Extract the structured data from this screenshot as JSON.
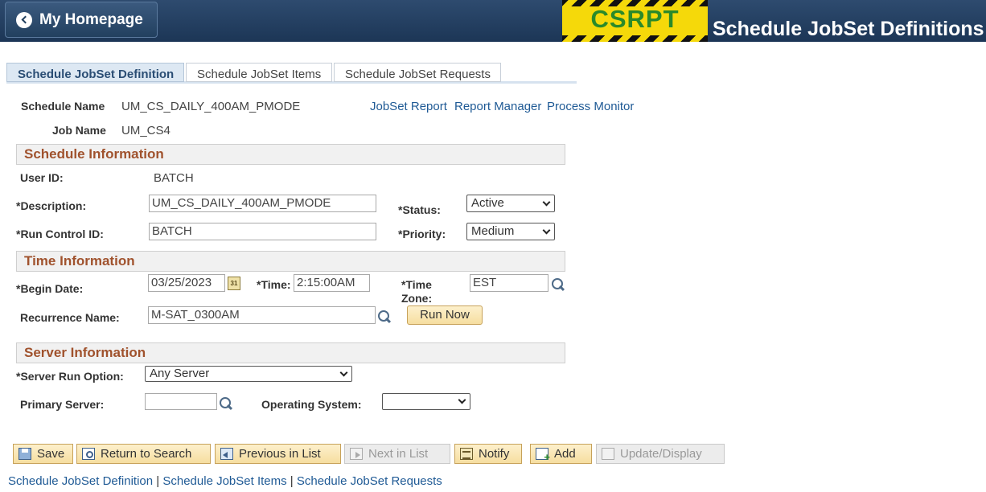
{
  "header": {
    "home_label": "My Homepage",
    "env_label": "CSRPT",
    "page_title": "Schedule JobSet Definitions"
  },
  "tabs": [
    {
      "label": "Schedule JobSet Definition",
      "active": true
    },
    {
      "label": "Schedule JobSet Items",
      "active": false
    },
    {
      "label": "Schedule JobSet Requests",
      "active": false
    }
  ],
  "top": {
    "schedule_name_label": "Schedule Name",
    "schedule_name": "UM_CS_DAILY_400AM_PMODE",
    "job_name_label": "Job Name",
    "job_name": "UM_CS4",
    "links": [
      "JobSet Report",
      "Report Manager",
      "Process Monitor"
    ]
  },
  "schedule_info": {
    "title": "Schedule Information",
    "user_id_label": "User ID:",
    "user_id": "BATCH",
    "description_label": "*Description:",
    "description": "UM_CS_DAILY_400AM_PMODE",
    "status_label": "*Status:",
    "status": "Active",
    "run_control_label": "*Run Control ID:",
    "run_control": "BATCH",
    "priority_label": "*Priority:",
    "priority": "Medium"
  },
  "time_info": {
    "title": "Time Information",
    "begin_date_label": "*Begin Date:",
    "begin_date": "03/25/2023",
    "calendar_text": "31",
    "time_label": "*Time:",
    "time": "2:15:00AM",
    "time_zone_label_1": "*Time",
    "time_zone_label_2": "Zone:",
    "time_zone": "EST",
    "recurrence_label": "Recurrence Name:",
    "recurrence": "M-SAT_0300AM",
    "run_now_label": "Run Now"
  },
  "server_info": {
    "title": "Server Information",
    "run_option_label": "*Server Run Option:",
    "run_option": "Any Server",
    "primary_server_label": "Primary Server:",
    "primary_server": "",
    "os_label": "Operating System:",
    "os": ""
  },
  "toolbar": {
    "save": "Save",
    "return_to_search": "Return to Search",
    "previous_in_list": "Previous in List",
    "next_in_list": "Next in List",
    "notify": "Notify",
    "add": "Add",
    "update_display": "Update/Display"
  },
  "bottom_links": [
    "Schedule JobSet Definition",
    "Schedule JobSet Items",
    "Schedule JobSet Requests"
  ],
  "bottom_separator": " | ",
  "colors": {
    "header_bg": "#1c3656",
    "section_title": "#a0522d",
    "link": "#1f5a95",
    "env_badge": "#f5d90a"
  }
}
